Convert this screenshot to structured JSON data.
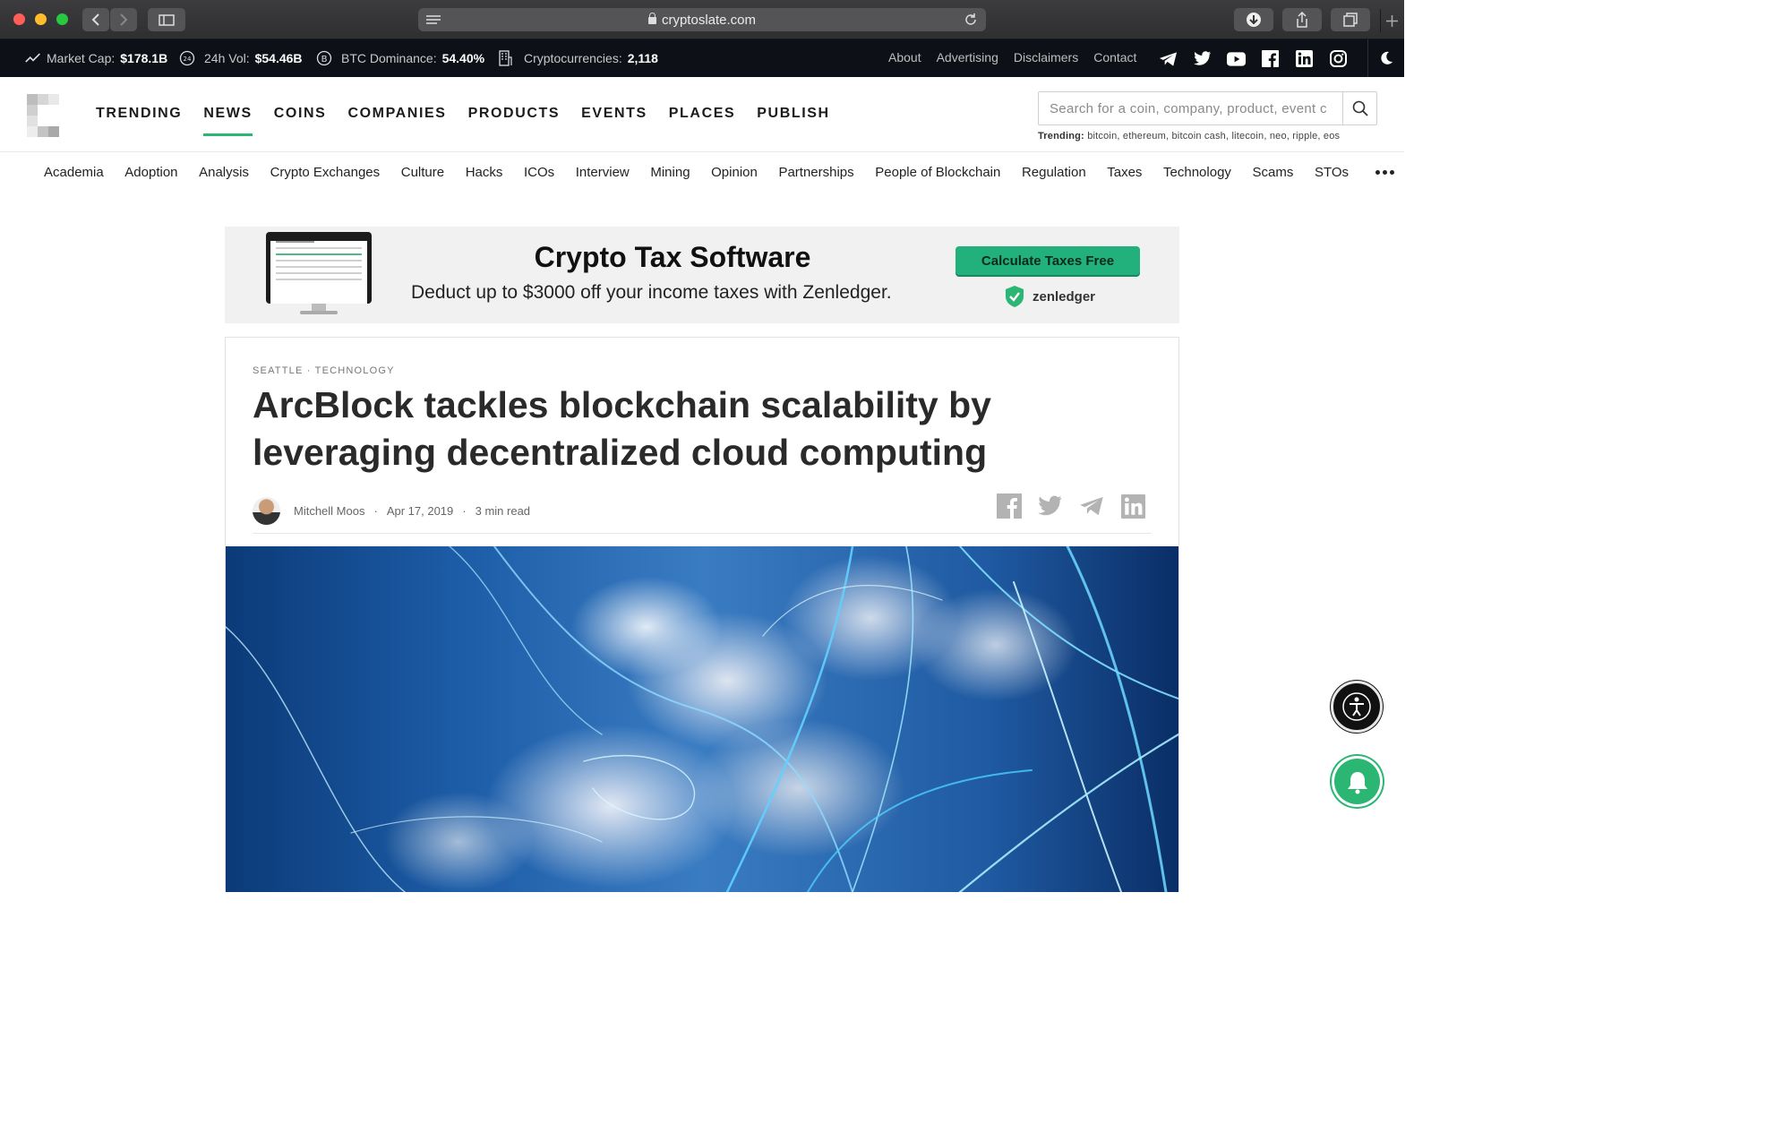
{
  "browser": {
    "url": "cryptoslate.com"
  },
  "ticker": {
    "market_cap_label": "Market Cap:",
    "market_cap_value": "$178.1B",
    "vol_label": "24h Vol:",
    "vol_value": "$54.46B",
    "dominance_label": "BTC Dominance:",
    "dominance_value": "54.40%",
    "cryptos_label": "Cryptocurrencies:",
    "cryptos_value": "2,118",
    "links": [
      "About",
      "Advertising",
      "Disclaimers",
      "Contact"
    ],
    "social_icons": [
      "telegram-icon",
      "twitter-icon",
      "youtube-icon",
      "facebook-icon",
      "linkedin-icon",
      "instagram-icon"
    ]
  },
  "header": {
    "nav": [
      "TRENDING",
      "NEWS",
      "COINS",
      "COMPANIES",
      "PRODUCTS",
      "EVENTS",
      "PLACES",
      "PUBLISH"
    ],
    "active_nav": "NEWS",
    "search_placeholder": "Search for a coin, company, product, event c",
    "trending_label": "Trending:",
    "trending_items": "bitcoin, ethereum, bitcoin cash, litecoin, neo, ripple, eos"
  },
  "categories": [
    "Academia",
    "Adoption",
    "Analysis",
    "Crypto Exchanges",
    "Culture",
    "Hacks",
    "ICOs",
    "Interview",
    "Mining",
    "Opinion",
    "Partnerships",
    "People of Blockchain",
    "Regulation",
    "Taxes",
    "Technology",
    "Scams",
    "STOs"
  ],
  "ad": {
    "title": "Crypto Tax Software",
    "subtitle": "Deduct up to $3000 off your income taxes with Zenledger.",
    "cta": "Calculate Taxes Free",
    "brand": "zenledger"
  },
  "article": {
    "crumb": "SEATTLE · TECHNOLOGY",
    "headline": "ArcBlock tackles blockchain scalability by leveraging decentralized cloud computing",
    "author": "Mitchell Moos",
    "date": "Apr 17, 2019",
    "read_time": "3 min read"
  },
  "colors": {
    "accent": "#2bb673",
    "ticker_bg": "#0d1117"
  }
}
